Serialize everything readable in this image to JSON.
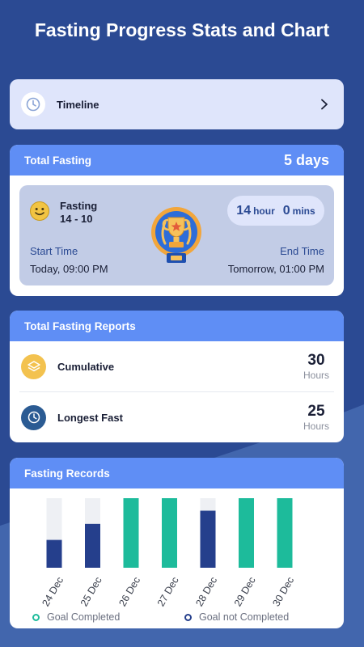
{
  "page": {
    "title": "Fasting Progress Stats and Chart"
  },
  "timeline": {
    "label": "Timeline",
    "icon": "clock-icon"
  },
  "total_fasting": {
    "header": "Total Fasting",
    "days": "5 days",
    "plan_name": "Fasting",
    "plan_ratio": "14 - 10",
    "duration_hours": "14",
    "duration_hours_unit": "hour",
    "duration_mins": "0",
    "duration_mins_unit": "mins",
    "start_label": "Start Time",
    "start_value": "Today, 09:00 PM",
    "end_label": "End Time",
    "end_value": "Tomorrow, 01:00 PM"
  },
  "reports": {
    "header": "Total Fasting Reports",
    "items": [
      {
        "label": "Cumulative",
        "value": "30",
        "unit": "Hours",
        "icon": "layers-icon"
      },
      {
        "label": "Longest Fast",
        "value": "25",
        "unit": "Hours",
        "icon": "clock-icon"
      }
    ]
  },
  "records": {
    "header": "Fasting Records",
    "legend": {
      "completed": "Goal Completed",
      "not_completed": "Goal not Completed"
    }
  },
  "colors": {
    "background": "#2b4a93",
    "header": "#5f8ef5",
    "completed": "#1dbb9b",
    "not_completed": "#253f8c",
    "track": "#eef0f4"
  },
  "chart_data": {
    "type": "bar",
    "categories": [
      "24 Dec",
      "25 Dec",
      "26 Dec",
      "27 Dec",
      "28 Dec",
      "29 Dec",
      "30 Dec"
    ],
    "values": [
      0.4,
      0.63,
      1.0,
      1.0,
      0.82,
      1.0,
      1.0
    ],
    "status": [
      "not_completed",
      "not_completed",
      "completed",
      "completed",
      "not_completed",
      "completed",
      "completed"
    ],
    "ylim": [
      0,
      1
    ],
    "legend": [
      "Goal Completed",
      "Goal not Completed"
    ]
  }
}
